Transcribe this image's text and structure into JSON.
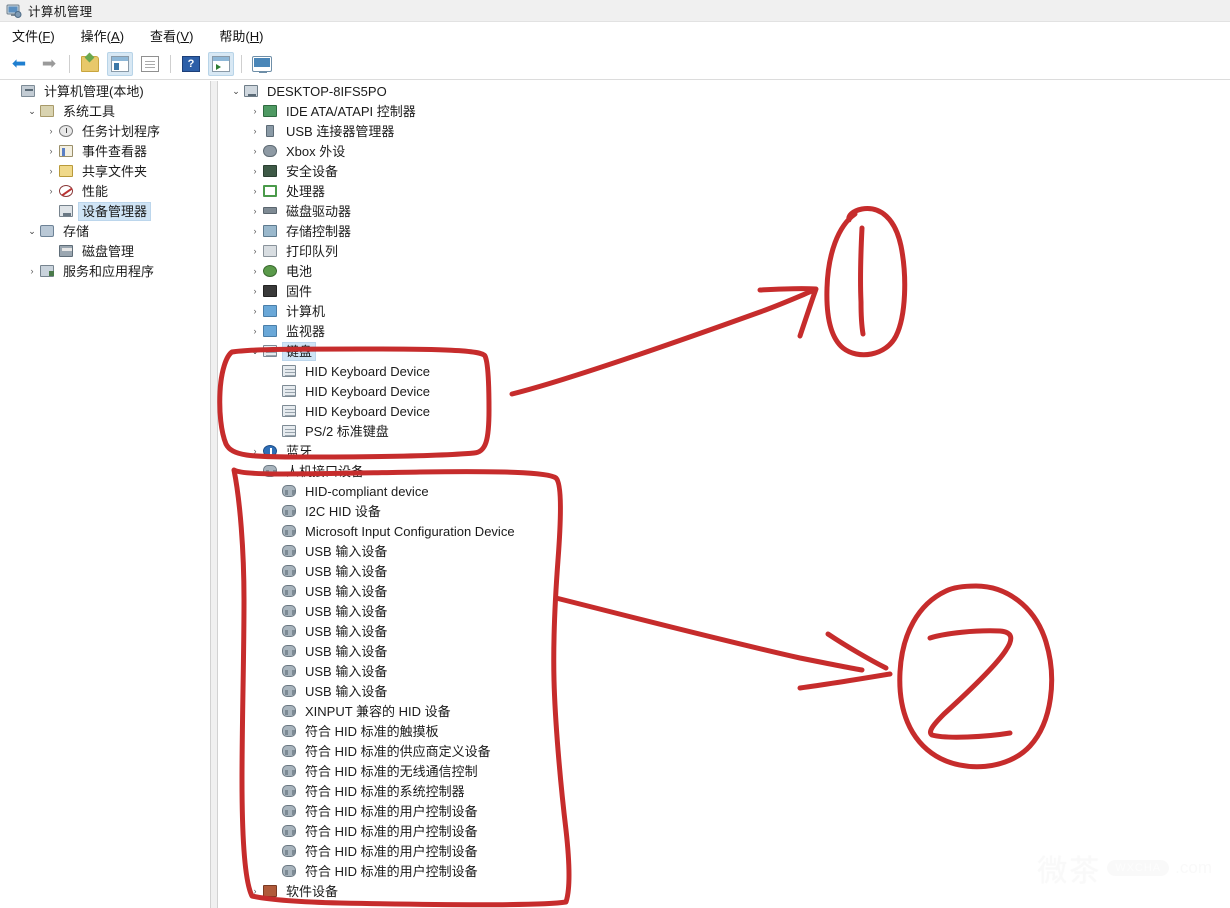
{
  "window": {
    "title": "计算机管理",
    "title_icon": "computer-management-icon"
  },
  "menu": [
    {
      "label": "文件",
      "accel": "F"
    },
    {
      "label": "操作",
      "accel": "A"
    },
    {
      "label": "查看",
      "accel": "V"
    },
    {
      "label": "帮助",
      "accel": "H"
    }
  ],
  "toolbar": [
    {
      "name": "back-button",
      "icon": "left-arrow-icon",
      "glyph": "←"
    },
    {
      "name": "forward-button",
      "icon": "right-arrow-icon",
      "glyph": "→"
    },
    {
      "name": "up-folder-button",
      "icon": "folder-up-icon"
    },
    {
      "name": "show-console-tree-button",
      "icon": "console-tree-icon"
    },
    {
      "name": "properties-button",
      "icon": "properties-icon"
    },
    {
      "name": "help-button",
      "icon": "help-icon",
      "glyph": "?"
    },
    {
      "name": "scan-hardware-button",
      "icon": "scan-window-icon"
    },
    {
      "name": "remote-console-button",
      "icon": "monitor-icon"
    }
  ],
  "sidebar": {
    "items": [
      {
        "label": "计算机管理(本地)",
        "indent": 0,
        "chev": "none",
        "icon": "computer-management-icon",
        "icon_class": "ti-mgr",
        "selected": false
      },
      {
        "label": "系统工具",
        "indent": 1,
        "chev": "open",
        "icon": "system-tools-icon",
        "icon_class": "ti-tools",
        "selected": false
      },
      {
        "label": "任务计划程序",
        "indent": 2,
        "chev": "closed",
        "icon": "task-scheduler-icon",
        "icon_class": "ti-clock",
        "selected": false
      },
      {
        "label": "事件查看器",
        "indent": 2,
        "chev": "closed",
        "icon": "event-viewer-icon",
        "icon_class": "ti-event",
        "selected": false
      },
      {
        "label": "共享文件夹",
        "indent": 2,
        "chev": "closed",
        "icon": "shared-folders-icon",
        "icon_class": "ti-share",
        "selected": false
      },
      {
        "label": "性能",
        "indent": 2,
        "chev": "closed",
        "icon": "performance-icon",
        "icon_class": "ti-perf",
        "selected": false
      },
      {
        "label": "设备管理器",
        "indent": 2,
        "chev": "none",
        "icon": "device-manager-icon",
        "icon_class": "ti-dev",
        "selected": true
      },
      {
        "label": "存储",
        "indent": 1,
        "chev": "open",
        "icon": "storage-icon",
        "icon_class": "ti-store",
        "selected": false
      },
      {
        "label": "磁盘管理",
        "indent": 2,
        "chev": "none",
        "icon": "disk-management-icon",
        "icon_class": "ti-disk",
        "selected": false
      },
      {
        "label": "服务和应用程序",
        "indent": 1,
        "chev": "closed",
        "icon": "services-and-applications-icon",
        "icon_class": "ti-svc",
        "selected": false
      }
    ]
  },
  "device_tree": {
    "items": [
      {
        "label": "DESKTOP-8IFS5PO",
        "indent": 0,
        "chev": "open",
        "icon": "computer-icon",
        "icon_class": "ti-pc",
        "selected": false
      },
      {
        "label": "IDE ATA/ATAPI 控制器",
        "indent": 1,
        "chev": "closed",
        "icon": "ide-controller-icon",
        "icon_class": "ti-ide",
        "selected": false
      },
      {
        "label": "USB 连接器管理器",
        "indent": 1,
        "chev": "closed",
        "icon": "usb-connector-icon",
        "icon_class": "ti-usb",
        "selected": false
      },
      {
        "label": "Xbox 外设",
        "indent": 1,
        "chev": "closed",
        "icon": "xbox-peripheral-icon",
        "icon_class": "ti-xbox",
        "selected": false
      },
      {
        "label": "安全设备",
        "indent": 1,
        "chev": "closed",
        "icon": "security-device-icon",
        "icon_class": "ti-sec",
        "selected": false
      },
      {
        "label": "处理器",
        "indent": 1,
        "chev": "closed",
        "icon": "processor-icon",
        "icon_class": "ti-cpu",
        "selected": false
      },
      {
        "label": "磁盘驱动器",
        "indent": 1,
        "chev": "closed",
        "icon": "disk-drive-icon",
        "icon_class": "ti-hdd",
        "selected": false
      },
      {
        "label": "存储控制器",
        "indent": 1,
        "chev": "closed",
        "icon": "storage-controller-icon",
        "icon_class": "ti-sctrl",
        "selected": false
      },
      {
        "label": "打印队列",
        "indent": 1,
        "chev": "closed",
        "icon": "print-queue-icon",
        "icon_class": "ti-print",
        "selected": false
      },
      {
        "label": "电池",
        "indent": 1,
        "chev": "closed",
        "icon": "battery-icon",
        "icon_class": "ti-batt",
        "selected": false
      },
      {
        "label": "固件",
        "indent": 1,
        "chev": "closed",
        "icon": "firmware-icon",
        "icon_class": "ti-fw",
        "selected": false
      },
      {
        "label": "计算机",
        "indent": 1,
        "chev": "closed",
        "icon": "computer-node-icon",
        "icon_class": "ti-mon2",
        "selected": false
      },
      {
        "label": "监视器",
        "indent": 1,
        "chev": "closed",
        "icon": "monitor-node-icon",
        "icon_class": "ti-mon2",
        "selected": false
      },
      {
        "label": "键盘",
        "indent": 1,
        "chev": "open",
        "icon": "keyboard-icon",
        "icon_class": "ti-kbd",
        "selected": true
      },
      {
        "label": "HID Keyboard Device",
        "indent": 2,
        "chev": "none",
        "icon": "keyboard-device-icon",
        "icon_class": "ti-kbd",
        "selected": false
      },
      {
        "label": "HID Keyboard Device",
        "indent": 2,
        "chev": "none",
        "icon": "keyboard-device-icon",
        "icon_class": "ti-kbd",
        "selected": false
      },
      {
        "label": "HID Keyboard Device",
        "indent": 2,
        "chev": "none",
        "icon": "keyboard-device-icon",
        "icon_class": "ti-kbd",
        "selected": false
      },
      {
        "label": "PS/2 标准键盘",
        "indent": 2,
        "chev": "none",
        "icon": "keyboard-device-icon",
        "icon_class": "ti-kbd",
        "selected": false
      },
      {
        "label": "蓝牙",
        "indent": 1,
        "chev": "closed",
        "icon": "bluetooth-icon",
        "icon_class": "ti-bt",
        "selected": false
      },
      {
        "label": "人机接口设备",
        "indent": 1,
        "chev": "open",
        "icon": "hid-icon",
        "icon_class": "ti-hid",
        "selected": false
      },
      {
        "label": "HID-compliant device",
        "indent": 2,
        "chev": "none",
        "icon": "hid-device-icon",
        "icon_class": "ti-hid",
        "selected": false
      },
      {
        "label": "I2C HID 设备",
        "indent": 2,
        "chev": "none",
        "icon": "hid-device-icon",
        "icon_class": "ti-hid",
        "selected": false
      },
      {
        "label": "Microsoft Input Configuration Device",
        "indent": 2,
        "chev": "none",
        "icon": "hid-device-icon",
        "icon_class": "ti-hid",
        "selected": false
      },
      {
        "label": "USB 输入设备",
        "indent": 2,
        "chev": "none",
        "icon": "hid-device-icon",
        "icon_class": "ti-hid",
        "selected": false
      },
      {
        "label": "USB 输入设备",
        "indent": 2,
        "chev": "none",
        "icon": "hid-device-icon",
        "icon_class": "ti-hid",
        "selected": false
      },
      {
        "label": "USB 输入设备",
        "indent": 2,
        "chev": "none",
        "icon": "hid-device-icon",
        "icon_class": "ti-hid",
        "selected": false
      },
      {
        "label": "USB 输入设备",
        "indent": 2,
        "chev": "none",
        "icon": "hid-device-icon",
        "icon_class": "ti-hid",
        "selected": false
      },
      {
        "label": "USB 输入设备",
        "indent": 2,
        "chev": "none",
        "icon": "hid-device-icon",
        "icon_class": "ti-hid",
        "selected": false
      },
      {
        "label": "USB 输入设备",
        "indent": 2,
        "chev": "none",
        "icon": "hid-device-icon",
        "icon_class": "ti-hid",
        "selected": false
      },
      {
        "label": "USB 输入设备",
        "indent": 2,
        "chev": "none",
        "icon": "hid-device-icon",
        "icon_class": "ti-hid",
        "selected": false
      },
      {
        "label": "USB 输入设备",
        "indent": 2,
        "chev": "none",
        "icon": "hid-device-icon",
        "icon_class": "ti-hid",
        "selected": false
      },
      {
        "label": "XINPUT 兼容的 HID 设备",
        "indent": 2,
        "chev": "none",
        "icon": "hid-device-icon",
        "icon_class": "ti-hid",
        "selected": false
      },
      {
        "label": "符合 HID 标准的触摸板",
        "indent": 2,
        "chev": "none",
        "icon": "hid-device-icon",
        "icon_class": "ti-hid",
        "selected": false
      },
      {
        "label": "符合 HID 标准的供应商定义设备",
        "indent": 2,
        "chev": "none",
        "icon": "hid-device-icon",
        "icon_class": "ti-hid",
        "selected": false
      },
      {
        "label": "符合 HID 标准的无线通信控制",
        "indent": 2,
        "chev": "none",
        "icon": "hid-device-icon",
        "icon_class": "ti-hid",
        "selected": false
      },
      {
        "label": "符合 HID 标准的系统控制器",
        "indent": 2,
        "chev": "none",
        "icon": "hid-device-icon",
        "icon_class": "ti-hid",
        "selected": false
      },
      {
        "label": "符合 HID 标准的用户控制设备",
        "indent": 2,
        "chev": "none",
        "icon": "hid-device-icon",
        "icon_class": "ti-hid",
        "selected": false
      },
      {
        "label": "符合 HID 标准的用户控制设备",
        "indent": 2,
        "chev": "none",
        "icon": "hid-device-icon",
        "icon_class": "ti-hid",
        "selected": false
      },
      {
        "label": "符合 HID 标准的用户控制设备",
        "indent": 2,
        "chev": "none",
        "icon": "hid-device-icon",
        "icon_class": "ti-hid",
        "selected": false
      },
      {
        "label": "符合 HID 标准的用户控制设备",
        "indent": 2,
        "chev": "none",
        "icon": "hid-device-icon",
        "icon_class": "ti-hid",
        "selected": false
      },
      {
        "label": "软件设备",
        "indent": 1,
        "chev": "closed",
        "icon": "software-device-icon",
        "icon_class": "ti-soft",
        "selected": false
      }
    ]
  },
  "annotations": {
    "color": "#c62c2c",
    "marks": [
      {
        "name": "callout-number-1",
        "text": "1"
      },
      {
        "name": "callout-number-2",
        "text": "2"
      }
    ]
  },
  "watermark": {
    "cn": "微茶",
    "badge": "WXCHA",
    "domain": ".com"
  }
}
